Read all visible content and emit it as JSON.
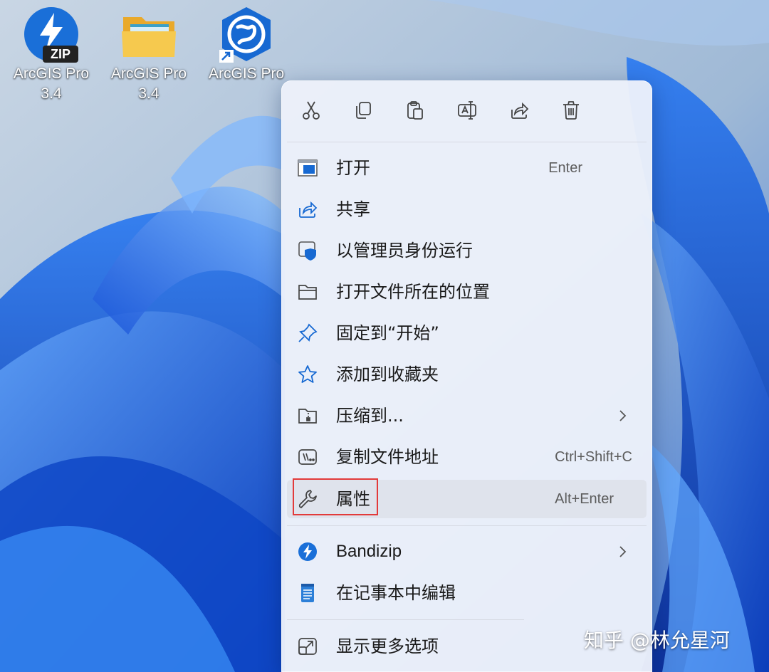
{
  "desktop": {
    "icons": [
      {
        "label": "ArcGIS Pro 3.4",
        "type": "zip-archive",
        "badge": "ZIP"
      },
      {
        "label": "ArcGIS Pro 3.4",
        "type": "folder"
      },
      {
        "label": "ArcGIS Pro",
        "type": "app-shortcut"
      }
    ]
  },
  "context_menu": {
    "toolbar": [
      "cut-icon",
      "copy-icon",
      "paste-icon",
      "rename-icon",
      "share-icon",
      "delete-icon"
    ],
    "items": [
      {
        "label": "打开",
        "shortcut": "Enter",
        "icon": "open-app-icon"
      },
      {
        "label": "共享",
        "icon": "share-icon"
      },
      {
        "label": "以管理员身份运行",
        "icon": "run-as-admin-shield-icon"
      },
      {
        "label": "打开文件所在的位置",
        "icon": "folder-icon"
      },
      {
        "label": "固定到“开始”",
        "icon": "pin-icon"
      },
      {
        "label": "添加到收藏夹",
        "icon": "star-icon"
      },
      {
        "label": "压缩到...",
        "icon": "zip-folder-icon",
        "submenu": true
      },
      {
        "label": "复制文件地址",
        "shortcut": "Ctrl+Shift+C",
        "icon": "copy-path-icon"
      },
      {
        "label": "属性",
        "shortcut": "Alt+Enter",
        "icon": "wrench-icon",
        "highlighted": true
      },
      {
        "label": "Bandizip",
        "icon": "bandizip-icon",
        "submenu": true
      },
      {
        "label": "在记事本中编辑",
        "icon": "notepad-icon"
      },
      {
        "label": "显示更多选项",
        "icon": "show-more-options-icon"
      }
    ]
  },
  "watermark": "知乎 @林允星河",
  "colors": {
    "highlight_border": "#e23a3a",
    "accent_blue": "#1769d2"
  }
}
